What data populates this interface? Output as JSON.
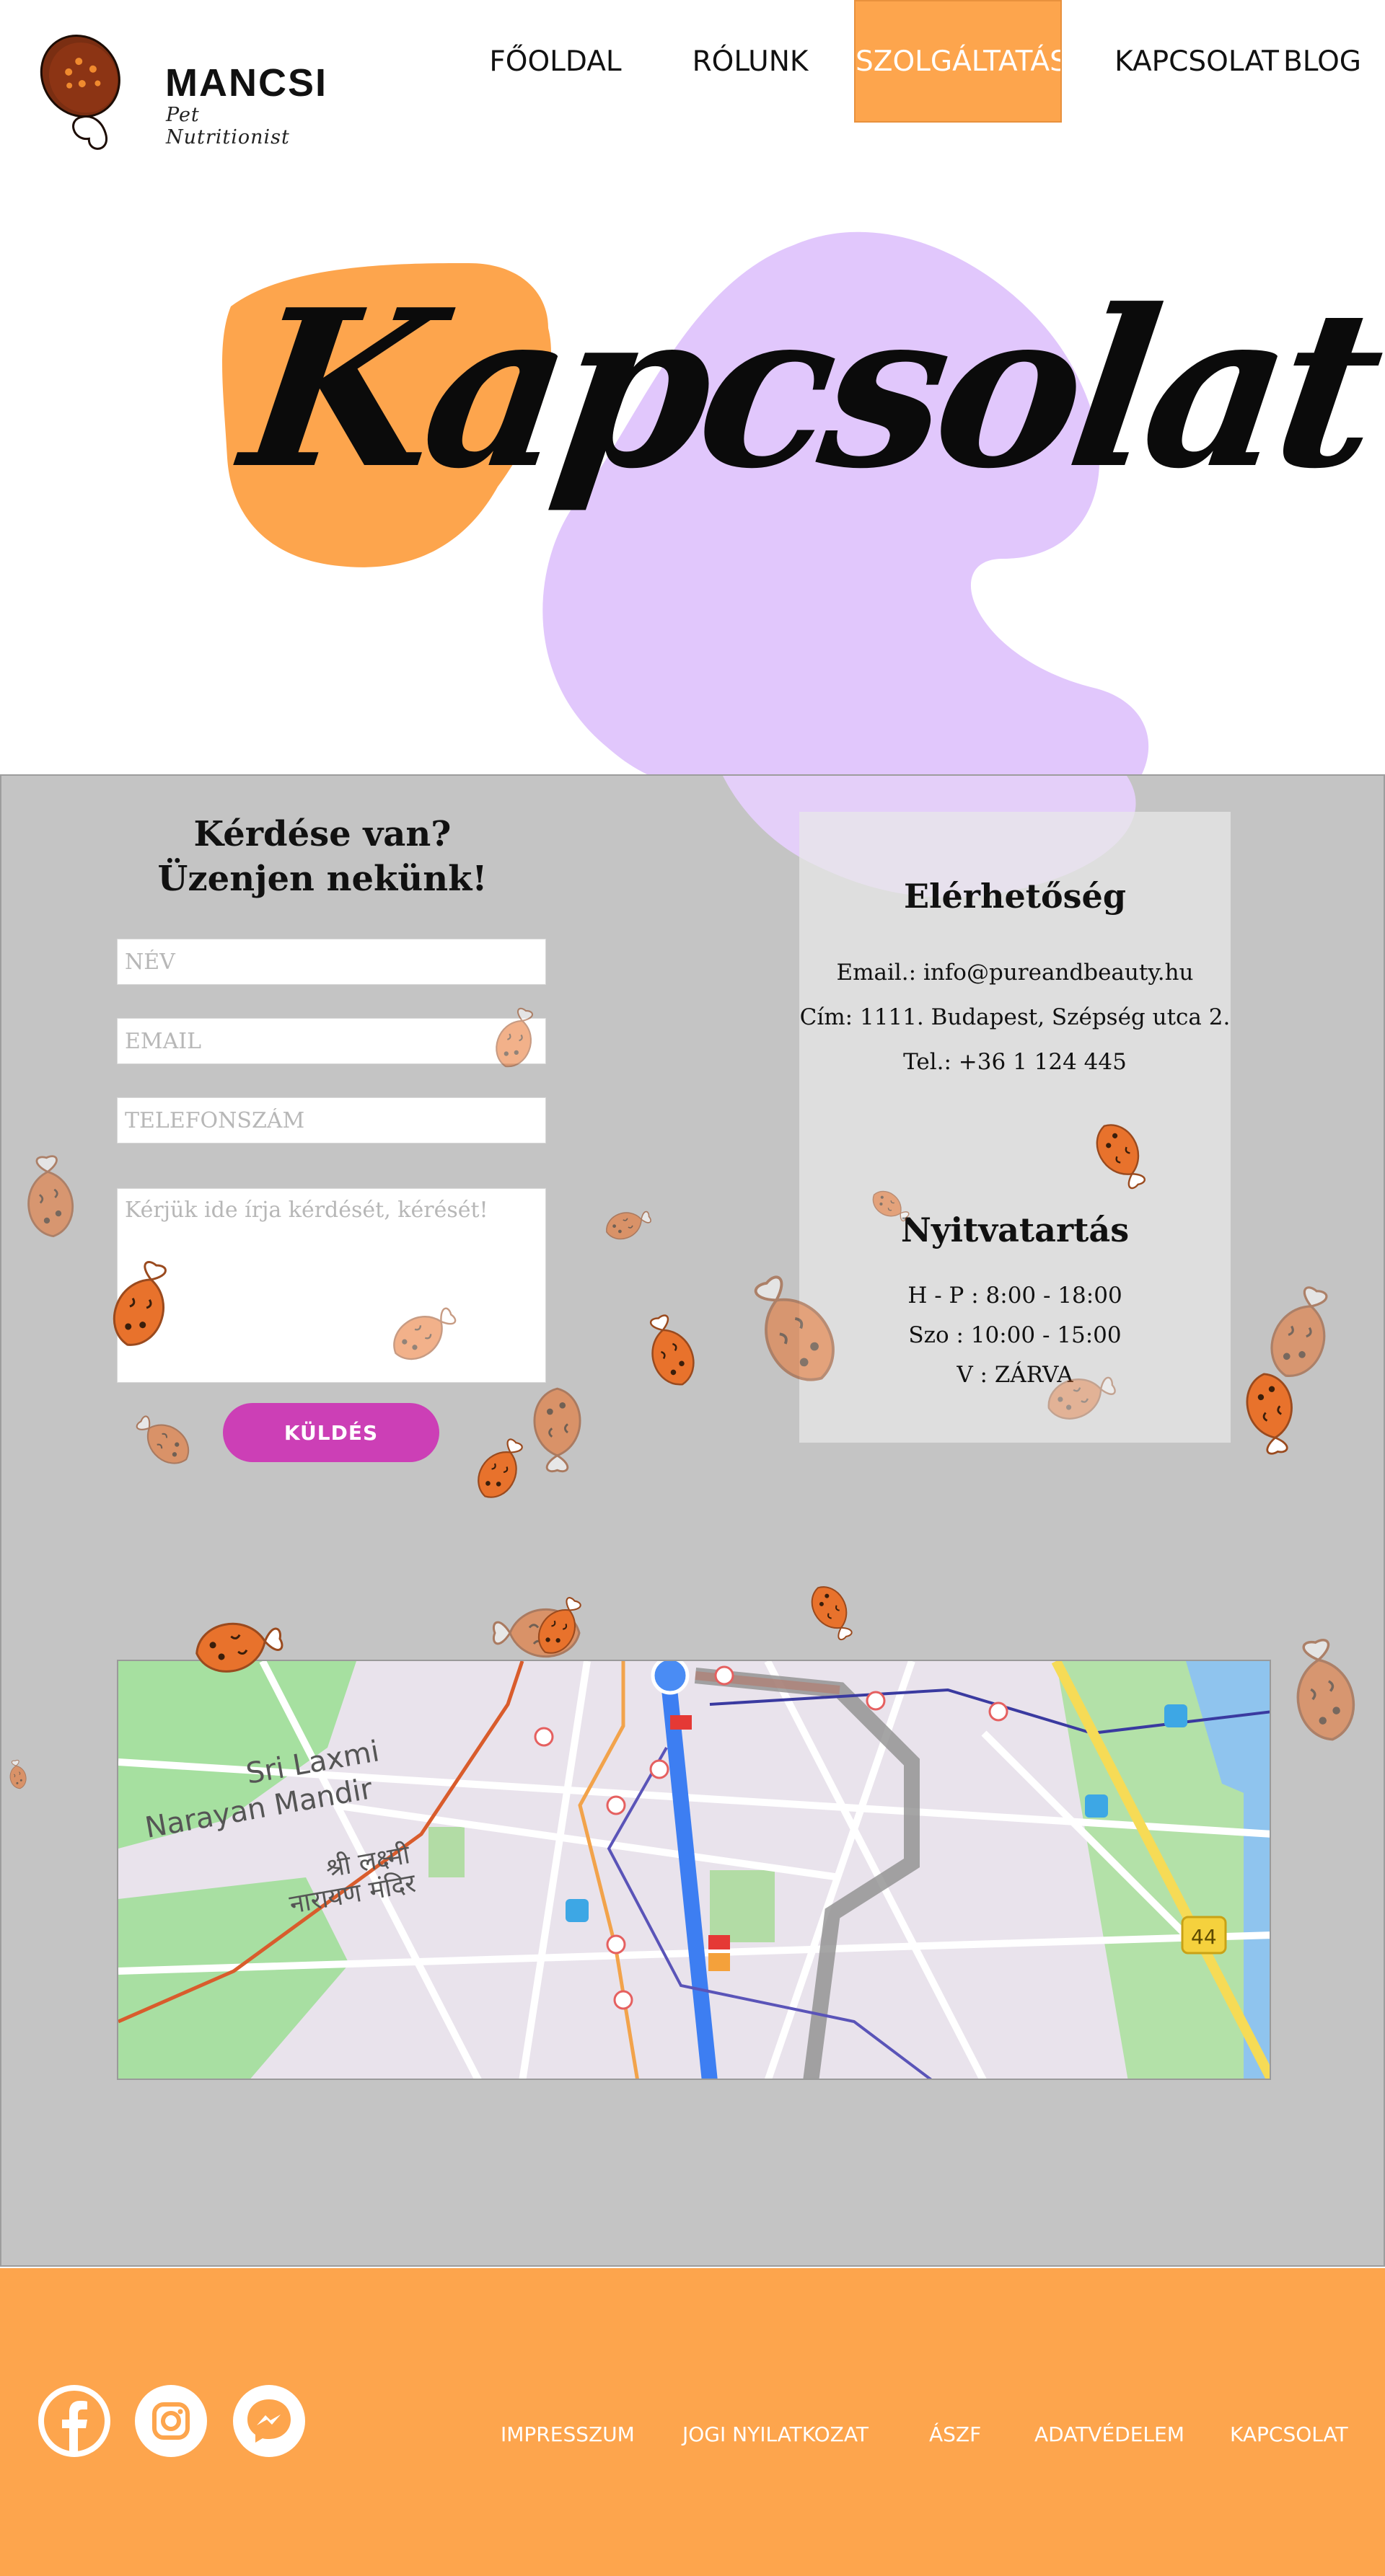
{
  "brand": {
    "name": "MANCSI",
    "tagline": "Pet Nutritionist"
  },
  "nav": {
    "items": [
      {
        "label": "FŐOLDAL"
      },
      {
        "label": "RÓLUNK"
      },
      {
        "label": "SZOLGÁLTATÁSI"
      },
      {
        "label": "KAPCSOLAT"
      },
      {
        "label": "BLOG"
      }
    ],
    "active": "SZOLGÁLTATÁSI"
  },
  "hero": {
    "title": "Kapcsolat"
  },
  "form": {
    "heading_line1": "Kérdése van?",
    "heading_line2": "Üzenjen nekünk!",
    "name_placeholder": "NÉV",
    "email_placeholder": "EMAIL",
    "phone_placeholder": "TELEFONSZÁM",
    "message_placeholder": "Kérjük ide írja kérdését, kérését!",
    "submit_label": "KÜLDÉS"
  },
  "contact_info": {
    "heading": "Elérhetőség",
    "email": "Email.: info@pureandbeauty.hu",
    "address": "Cím: 1111. Budapest, Szépség utca 2.",
    "phone": "Tel.: +36 1 124 445"
  },
  "opening_hours": {
    "heading": "Nyitvatartás",
    "lines": [
      "H - P : 8:00 - 18:00",
      "Szo : 10:00 - 15:00",
      "V : ZÁRVA"
    ]
  },
  "map": {
    "labels": {
      "place_name": "Sri Laxmi",
      "place_name2": "Narayan Mandir",
      "devanagari1": "श्री लक्ष्मी",
      "devanagari2": "नारायण मंदिर",
      "road_number": "44"
    }
  },
  "footer": {
    "socials": [
      {
        "icon": "facebook-icon"
      },
      {
        "icon": "instagram-icon"
      },
      {
        "icon": "messenger-icon"
      }
    ],
    "links": [
      {
        "label": "IMPRESSZUM"
      },
      {
        "label": "JOGI NYILATKOZAT"
      },
      {
        "label": "ÁSZF"
      },
      {
        "label": "ADATVÉDELEM"
      },
      {
        "label": "KAPCSOLAT"
      }
    ]
  },
  "colors": {
    "accent_orange": "#fda54d",
    "blob_purple": "#dfc4fc",
    "section_grey": "#c4c4c4",
    "button_magenta": "#cc3fb6",
    "fish_orange": "#e8722c"
  }
}
